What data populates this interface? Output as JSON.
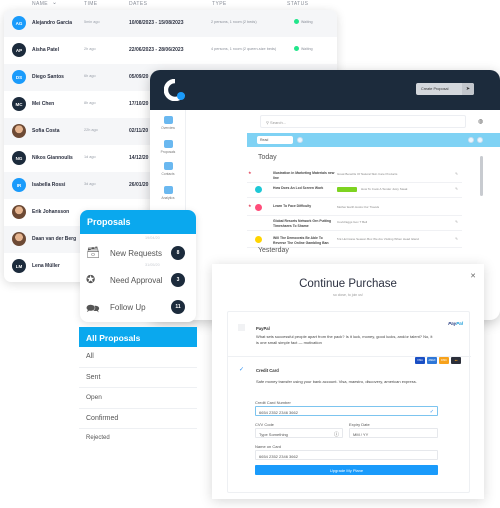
{
  "table": {
    "headers": {
      "name": "NAME",
      "time": "TIME",
      "dates": "DATES",
      "type": "TYPE",
      "status": "STATUS"
    },
    "rows": [
      {
        "initials": "AG",
        "avatar_color": "#1a9bfb",
        "name": "Alejandro Garcia",
        "time": "5min ago",
        "dates": "10/08/2023 - 15/08/2023",
        "type": "2 persons, 1 room (2 beds)",
        "status": "Waiting"
      },
      {
        "initials": "AP",
        "avatar_color": "#1c2b3c",
        "name": "Aisha Patel",
        "time": "2h ago",
        "dates": "22/06/2023 - 28/06/2023",
        "type": "4 persons, 1 room (2 queen-size beds)",
        "status": "Waiting"
      },
      {
        "initials": "DS",
        "avatar_color": "#1a9bfb",
        "name": "Diego Santos",
        "time": "6h ago",
        "dates": "05/09/20",
        "type": "",
        "status": ""
      },
      {
        "initials": "MC",
        "avatar_color": "#1c2b3c",
        "name": "Mei Chen",
        "time": "8h ago",
        "dates": "17/10/20",
        "type": "",
        "status": ""
      },
      {
        "initials": "",
        "avatar_color": "photo",
        "name": "Sofia Costa",
        "time": "22h ago",
        "dates": "02/11/20",
        "type": "",
        "status": ""
      },
      {
        "initials": "NG",
        "avatar_color": "#1c2b3c",
        "name": "Nikos Giannoulis",
        "time": "1d ago",
        "dates": "14/12/20",
        "type": "",
        "status": ""
      },
      {
        "initials": "IR",
        "avatar_color": "#1a9bfb",
        "name": "Isabella Rossi",
        "time": "3d ago",
        "dates": "26/01/20",
        "type": "",
        "status": ""
      },
      {
        "initials": "",
        "avatar_color": "photo",
        "name": "Erik Johansson",
        "time": "",
        "dates": "",
        "type": "",
        "status": ""
      },
      {
        "initials": "",
        "avatar_color": "photo",
        "name": "Daan van der Berg",
        "time": "1w ago",
        "dates": "19/04/20",
        "type": "",
        "status": ""
      },
      {
        "initials": "LM",
        "avatar_color": "#1c2b3c",
        "name": "Lena Müller",
        "time": "1w ago",
        "dates": "31/05/20",
        "type": "",
        "status": ""
      }
    ]
  },
  "dashboard": {
    "create_button": "Create Proposal",
    "sidebar": [
      "Overview",
      "Proposals",
      "Contacts",
      "Analytics"
    ],
    "search_placeholder": "Search...",
    "filter_value": "Read",
    "today_label": "Today",
    "yesterday_label": "Yesterday",
    "items": [
      {
        "title": "Illustration in Marketing Materials new line",
        "desc": "Great Benefits Of Natural Skin Care Products",
        "dot": "",
        "starred": true
      },
      {
        "title": "How Does An Lcd Screen Work",
        "desc": "How To Cook A Tender Juicy Steak",
        "dot": "#1ec8d6",
        "starred": false,
        "tag": true
      },
      {
        "title": "Learn To Face Difficulty",
        "desc": "Mother Earth Hosts Our Travels",
        "dot": "#ff4d7a",
        "starred": true
      },
      {
        "title": "Global Resorts Network Grn Putting Timeshares To Shame",
        "desc": "Covid Eggs Gov T Bell",
        "dot": "",
        "starred": false
      },
      {
        "title": "Will The Democrats Be Able To Reverse The Online Gambling Ban",
        "desc": "5 E Hurricane Season Box We Are Visiting When Head Island",
        "dot": "#ffd400",
        "starred": false
      }
    ]
  },
  "proposals": {
    "title": "Proposals",
    "items": [
      {
        "label": "New Requests",
        "count": "8",
        "icon": "inbox-tray-icon"
      },
      {
        "label": "Need Approval",
        "count": "3",
        "icon": "badge-check-icon"
      },
      {
        "label": "Follow Up",
        "count": "11",
        "icon": "chat-bubbles-icon"
      }
    ],
    "all_title": "All Proposals",
    "filters": [
      "All",
      "Sent",
      "Open",
      "Confirmed",
      "Rejected"
    ]
  },
  "purchase": {
    "title": "Continue Purchase",
    "subtitle": "so close, to join us!",
    "paypal": {
      "title": "PayPal",
      "desc": "What sets successful people apart from the pack? Is it luck, money, good lucks, and/or talent? No, it is one small simple fact — motivation",
      "logo_a": "Pay",
      "logo_b": "Pal"
    },
    "credit_card": {
      "title": "Credit Card",
      "desc": "Safe money transfer using your bank account. Visa, maestro, discovery, american express.",
      "brands": [
        "VISA",
        "AMEX",
        "DISC",
        "MC"
      ]
    },
    "fields": {
      "card_number_label": "Credit Card Number",
      "card_number_value": "6654 2352 2346 3662",
      "cvv_label": "CVV Code",
      "cvv_placeholder": "Type Something",
      "expiry_label": "Expiry Date",
      "expiry_placeholder": "MM / YY",
      "name_label": "Name on Card",
      "name_value": "6654 2352 2346 3662"
    },
    "submit": "Upgrade My Plane"
  }
}
